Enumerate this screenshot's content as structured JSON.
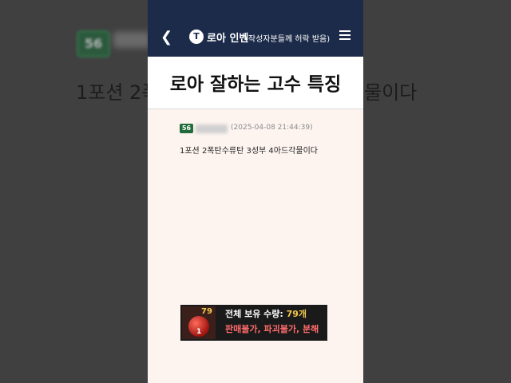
{
  "header": {
    "title": "로아 인벤",
    "subtitle": "(작성자분들께 허락 받음)"
  },
  "page_title": "로아 잘하는 고수 특징",
  "post": {
    "level": "56",
    "date": "(2025-04-08 21:44:39)",
    "body": "1포션 2폭탄수류탄 3성부 4아드각물이다"
  },
  "background": {
    "level": "56",
    "text_left": "1포션 2폭",
    "text_right": "물이다"
  },
  "item": {
    "level": "79",
    "count": "1",
    "holdings_label": "전체 보유 수량:",
    "holdings_value": "79개",
    "restrictions": "판매불가, 파괴불가, 분해"
  },
  "icons": {
    "back": "chevron-left-icon",
    "logo": "inven-logo-icon",
    "menu": "hamburger-menu-icon"
  },
  "colors": {
    "header_bg": "#1c2b4a",
    "post_bg": "#fdf4f0",
    "level_badge": "#1f6b3c",
    "item_gold": "#f2c94c",
    "item_red": "#ff6b6b"
  }
}
